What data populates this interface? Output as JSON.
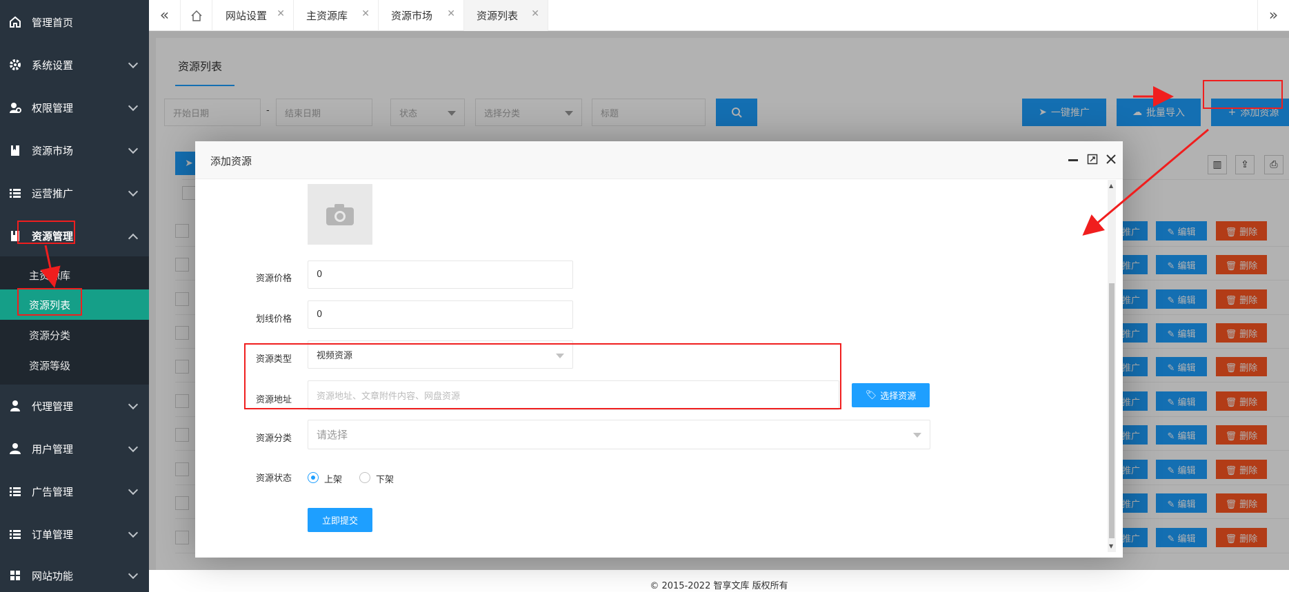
{
  "sidebar": {
    "items": [
      {
        "label": "管理首页",
        "icon": "home-icon"
      },
      {
        "label": "系统设置",
        "icon": "gear-icon"
      },
      {
        "label": "权限管理",
        "icon": "permission-icon"
      },
      {
        "label": "资源市场",
        "icon": "bookmark-icon"
      },
      {
        "label": "运营推广",
        "icon": "list-icon"
      },
      {
        "label": "资源管理",
        "icon": "resource-icon"
      },
      {
        "label": "代理管理",
        "icon": "agent-icon"
      },
      {
        "label": "用户管理",
        "icon": "user-icon"
      },
      {
        "label": "广告管理",
        "icon": "list-icon"
      },
      {
        "label": "订单管理",
        "icon": "list-icon"
      },
      {
        "label": "网站功能",
        "icon": "puzzle-icon"
      }
    ],
    "sub_items": [
      "主资源库",
      "资源列表",
      "资源分类",
      "资源等级"
    ]
  },
  "tabs": [
    "网站设置",
    "主资源库",
    "资源市场",
    "资源列表"
  ],
  "page": {
    "title": "资源列表",
    "filters": {
      "start_date": "开始日期",
      "separator": "-",
      "end_date": "结束日期",
      "status": "状态",
      "category": "选择分类",
      "title": "标题"
    },
    "buttons": {
      "promote": "一键推广",
      "batch_import": "批量导入",
      "add_resource": "添加资源"
    },
    "row_actions": {
      "promote_partial": "推广",
      "edit": "编辑",
      "delete": "删除"
    }
  },
  "modal": {
    "title": "添加资源",
    "fields": {
      "price_label": "资源价格",
      "price_value": "0",
      "strike_price_label": "划线价格",
      "strike_price_value": "0",
      "type_label": "资源类型",
      "type_value": "视频资源",
      "address_label": "资源地址",
      "address_placeholder": "资源地址、文章附件内容、网盘资源",
      "select_resource_button": "选择资源",
      "category_label": "资源分类",
      "category_placeholder": "请选择",
      "status_label": "资源状态",
      "status_on": "上架",
      "status_off": "下架",
      "submit": "立即提交"
    }
  },
  "footer": {
    "copyright": "© 2015-2022 智享文库 版权所有"
  },
  "colors": {
    "sidebar_bg": "#28333e",
    "active_green": "#159f88",
    "primary_blue": "#1e9fff",
    "danger_red": "#ff5722",
    "annotation_red": "#f01e1e"
  }
}
